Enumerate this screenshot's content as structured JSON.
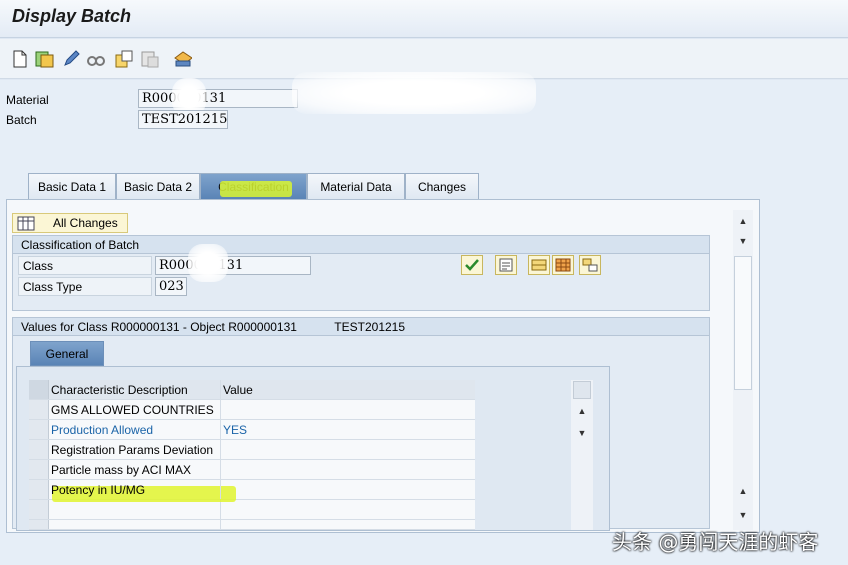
{
  "window": {
    "title": "Display Batch"
  },
  "toolbar": {
    "icons": [
      "new-document-icon",
      "other-batch-icon",
      "edit-pencil-icon",
      "glasses-display-icon",
      "create-icon",
      "where-used-icon",
      "print-icon"
    ]
  },
  "header": {
    "material_label": "Material",
    "material_value": "R000000131",
    "batch_label": "Batch",
    "batch_value": "TEST201215"
  },
  "tabs": [
    {
      "label": "Basic Data 1"
    },
    {
      "label": "Basic Data 2"
    },
    {
      "label": "Classification",
      "active": true
    },
    {
      "label": "Material Data"
    },
    {
      "label": "Changes"
    }
  ],
  "classification": {
    "all_changes_label": "All Changes",
    "group_title": "Classification of Batch",
    "class_label": "Class",
    "class_value": "R000000131",
    "class_type_label": "Class Type",
    "class_type_value": "023"
  },
  "values": {
    "group_title": "Values for Class R000000131 - Object R000000131",
    "object_batch": "TEST201215",
    "subtab_label": "General",
    "columns": [
      "Characteristic Description",
      "Value"
    ],
    "rows": [
      {
        "desc": "GMS ALLOWED COUNTRIES",
        "value": ""
      },
      {
        "desc": "Production Allowed",
        "value": "YES"
      },
      {
        "desc": "Registration Params Deviation",
        "value": ""
      },
      {
        "desc": "Particle mass by ACI MAX",
        "value": ""
      },
      {
        "desc": "Potency in IU/MG",
        "value": ""
      },
      {
        "desc": "",
        "value": ""
      },
      {
        "desc": "",
        "value": ""
      }
    ]
  },
  "watermark": "头条 @勇闯天涯的虾客",
  "colors": {
    "highlight": "#d9f531",
    "link": "#1b64a8",
    "active_tab": "#6f95c3"
  }
}
